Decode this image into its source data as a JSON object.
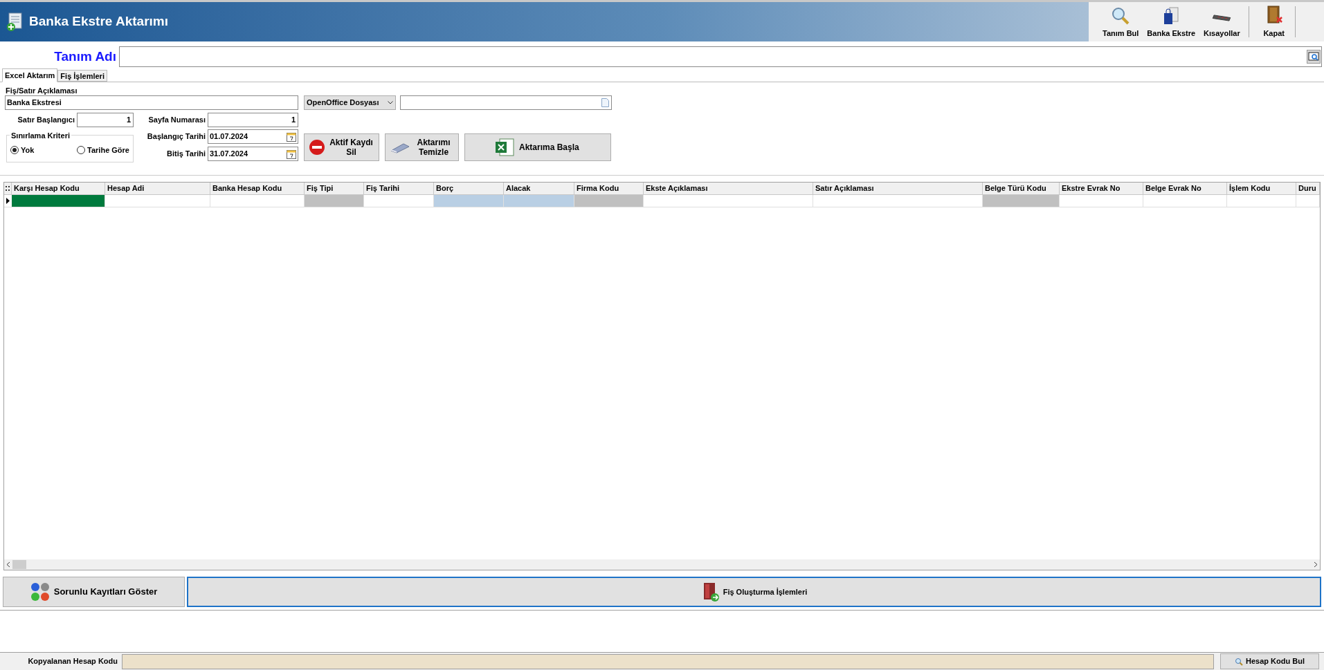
{
  "window": {
    "title": "Banka Ekstre Aktarımı"
  },
  "toolbar": [
    "Tanım Bul",
    "Banka Ekstre",
    "Kısayollar",
    "Kapat"
  ],
  "definition": {
    "label": "Tanım Adı"
  },
  "tabs": [
    {
      "label": "Excel Aktarım",
      "selected": true
    },
    {
      "label": "Fiş İşlemleri",
      "selected": false
    }
  ],
  "form": {
    "description_label": "Fiş/Satır Açıklaması",
    "description_value": "Banka Ekstresi",
    "file_type": "OpenOffice Dosyası",
    "row_start_label": "Satır Başlangıcı",
    "row_start_value": "1",
    "page_label": "Sayfa Numarası",
    "page_value": "1",
    "criteria_label": "Sınırlama Kriteri",
    "criteria": [
      {
        "label": "Yok",
        "selected": true
      },
      {
        "label": "Tarihe Göre",
        "selected": false
      }
    ],
    "start_date_label": "Başlangıç Tarihi",
    "start_date": "01.07.2024",
    "end_date_label": "Bitiş Tarihi",
    "end_date": "31.07.2024"
  },
  "actions": [
    "Aktif Kaydı Sil",
    "Aktarımı Temizle",
    "Aktarıma Başla"
  ],
  "table": {
    "columns": [
      {
        "label": "Karşı Hesap Kodu",
        "color": "#007a3d"
      },
      {
        "label": "Hesap Adi",
        "color": "#ffffff"
      },
      {
        "label": "Banka Hesap Kodu",
        "color": "#ffffff"
      },
      {
        "label": "Fiş Tipi",
        "color": "#c0c0c0"
      },
      {
        "label": "Fiş Tarihi",
        "color": "#ffffff"
      },
      {
        "label": "Borç",
        "color": "#b9cfe4"
      },
      {
        "label": "Alacak",
        "color": "#b9cfe4"
      },
      {
        "label": "Firma Kodu",
        "color": "#c0c0c0"
      },
      {
        "label": "Ekste Açıklaması",
        "color": "#ffffff"
      },
      {
        "label": "Satır Açıklaması",
        "color": "#ffffff"
      },
      {
        "label": "Belge Türü Kodu",
        "color": "#c0c0c0"
      },
      {
        "label": "Ekstre Evrak No",
        "color": "#ffffff"
      },
      {
        "label": "Belge Evrak No",
        "color": "#ffffff"
      },
      {
        "label": "İşlem Kodu",
        "color": "#ffffff"
      },
      {
        "label": "Duru",
        "color": "#ffffff"
      }
    ]
  },
  "bottom_buttons": [
    "Sorunlu Kayıtları Göster",
    "Fiş Oluşturma İşlemleri"
  ],
  "status_bar": {
    "label": "Kopyalanan Hesap Kodu",
    "button": "Hesap Kodu Bul"
  }
}
